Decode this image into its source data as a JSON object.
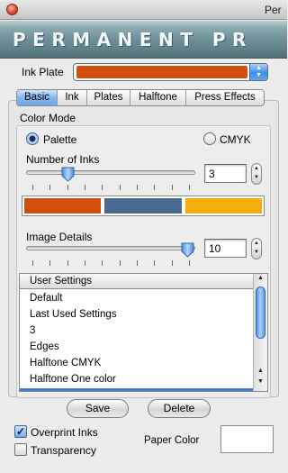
{
  "window": {
    "title": "Per"
  },
  "banner": {
    "text": "PERMANENT PR"
  },
  "ink_plate": {
    "label": "Ink Plate",
    "color": "#d14e0c"
  },
  "tabs": [
    {
      "label": "Basic",
      "active": true
    },
    {
      "label": "Ink"
    },
    {
      "label": "Plates"
    },
    {
      "label": "Halftone"
    },
    {
      "label": "Press Effects"
    }
  ],
  "color_mode": {
    "label": "Color Mode",
    "palette_label": "Palette",
    "cmyk_label": "CMYK",
    "selected": "Palette"
  },
  "number_of_inks": {
    "label": "Number of Inks",
    "value": "3",
    "slider_fraction": 0.25
  },
  "ink_swatches": [
    "#d14e0c",
    "#4a6a92",
    "#f7ad0c"
  ],
  "image_details": {
    "label": "Image Details",
    "value": "10",
    "slider_fraction": 1.0
  },
  "settings_list": {
    "header": "User Settings",
    "items": [
      "Default",
      "Last Used Settings",
      "3",
      "Edges",
      "Halftone CMYK",
      "Halftone One color"
    ]
  },
  "buttons": {
    "save": "Save",
    "delete": "Delete"
  },
  "overprint_inks": {
    "label": "Overprint Inks",
    "checked": true
  },
  "transparency": {
    "label": "Transparency",
    "checked": false
  },
  "paper_color": {
    "label": "Paper Color",
    "color": "#ffffff"
  }
}
